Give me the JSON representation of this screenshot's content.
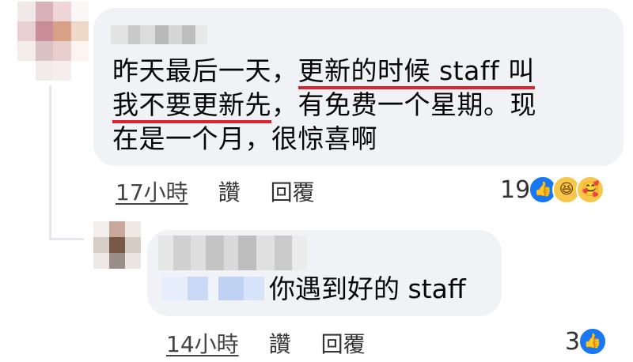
{
  "comment": {
    "author": "",
    "line1_part1": "昨天最后一天，",
    "line1_part2": "更新的时候 staff 叫",
    "line2_part1": "我不要更新先",
    "line2_part2": "，有免费一个星期。现",
    "line3": "在是一个月，很惊喜啊",
    "time": "17小時",
    "like_label": "讚",
    "reply_label": "回覆",
    "reaction_count": "19",
    "reactions": [
      "like-icon",
      "haha-icon",
      "care-icon"
    ]
  },
  "reply": {
    "author": "",
    "mention": "",
    "text": "你遇到好的 staff",
    "time": "14小時",
    "like_label": "讚",
    "reply_label": "回覆",
    "reaction_count": "3",
    "reactions": [
      "like-icon"
    ]
  },
  "colors": {
    "bubble": "#f0f2f5",
    "underline": "#e0202a",
    "like_blue": "#1877f2",
    "emoji_yellow": "#f7c64a"
  }
}
